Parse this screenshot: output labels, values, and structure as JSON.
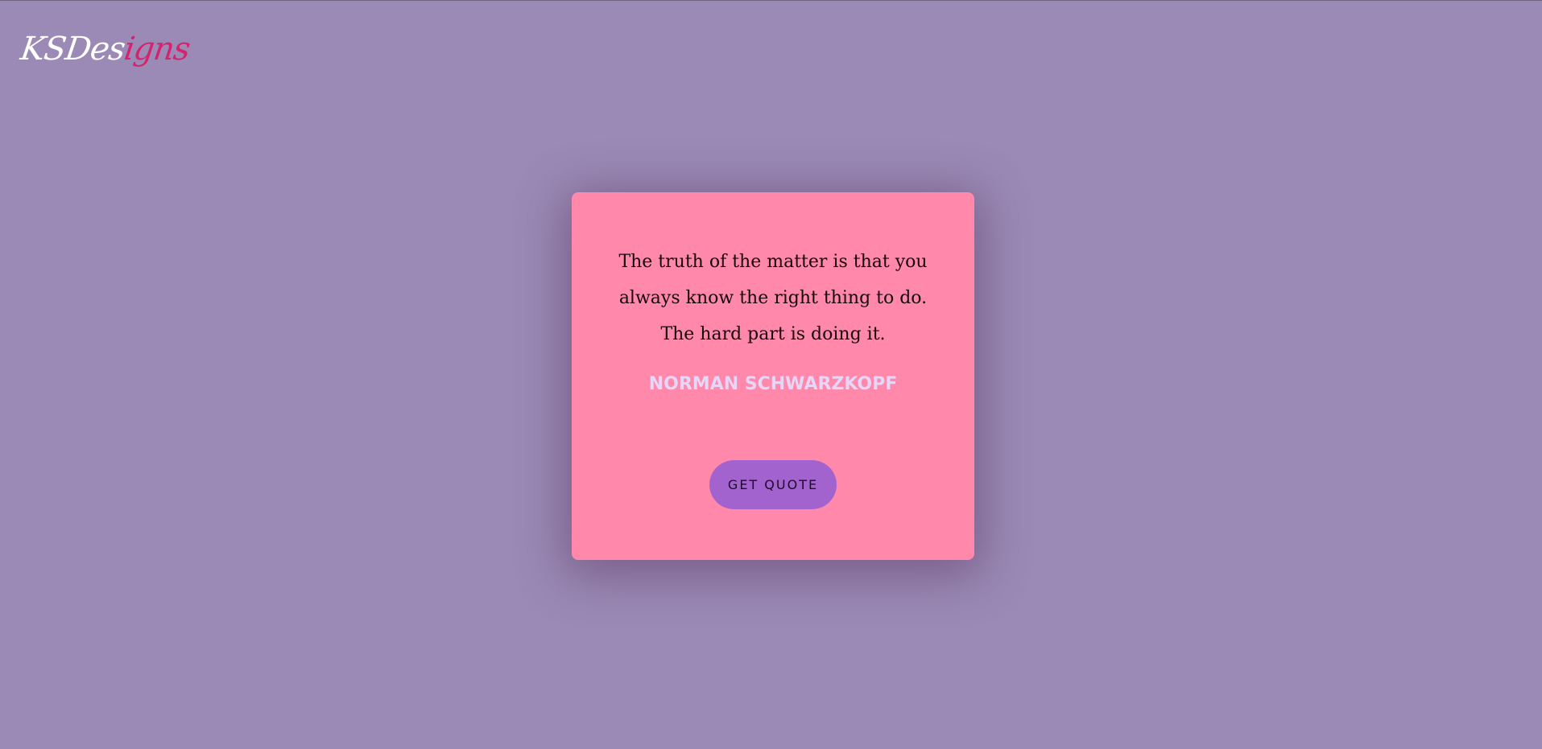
{
  "logo": {
    "part_a": "KSDes",
    "part_b": "igns"
  },
  "quote": {
    "text": "The truth of the matter is that you always know the right thing to do. The hard part is doing it.",
    "author": "NORMAN SCHWARZKOPF",
    "button_label": "GET QUOTE"
  },
  "colors": {
    "background": "#9b8ab6",
    "card": "#ff88ab",
    "button": "#a263cf",
    "author": "#e6d6f7",
    "logo_accent": "#d4246e"
  }
}
